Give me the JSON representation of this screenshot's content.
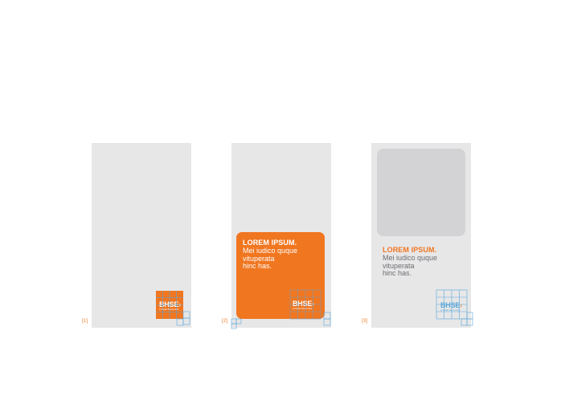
{
  "brand": {
    "name": "BHSE",
    "tagline": "by Health Science Edu",
    "orange": "#f07620",
    "blue": "#5aa7d8",
    "panel_gray": "#e7e7e8",
    "placeholder_gray": "#d3d3d5"
  },
  "panels": [
    {
      "number": "[1]"
    },
    {
      "number": "[2]",
      "headline": "LOREM IPSUM.",
      "body": "Mei iudico quque\nvituperata\nhinc has."
    },
    {
      "number": "[3]",
      "headline": "LOREM IPSUM.",
      "body": "Mei iudico quque\nvituperata\nhinc has."
    }
  ]
}
